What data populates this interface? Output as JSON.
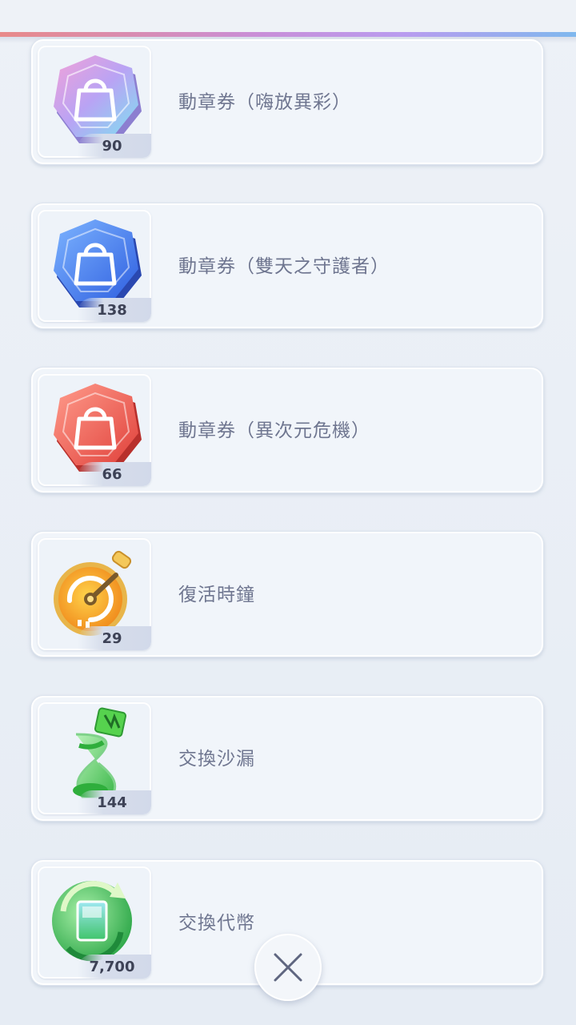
{
  "items": [
    {
      "name": "動章券（嗨放異彩）",
      "count": "90",
      "icon": "medal-ticket-pink-icon",
      "color": "#c89ae8"
    },
    {
      "name": "動章券（雙天之守護者）",
      "count": "138",
      "icon": "medal-ticket-blue-icon",
      "color": "#4f7ff0"
    },
    {
      "name": "動章券（異次元危機）",
      "count": "66",
      "icon": "medal-ticket-red-icon",
      "color": "#f06a5c"
    },
    {
      "name": "復活時鐘",
      "count": "29",
      "icon": "revive-clock-icon",
      "color": "#f2a636"
    },
    {
      "name": "交換沙漏",
      "count": "144",
      "icon": "exchange-hourglass-icon",
      "color": "#5ed46c"
    },
    {
      "name": "交換代幣",
      "count": "7,700",
      "icon": "exchange-token-icon",
      "color": "#52c96a"
    }
  ],
  "close_button": {
    "icon": "close-icon"
  },
  "colors": {
    "accent_line": [
      "#e88a8a",
      "#c98fd8",
      "#7fb8ee"
    ],
    "card_bg": "#f1f5fa",
    "text": "#6f7690"
  }
}
